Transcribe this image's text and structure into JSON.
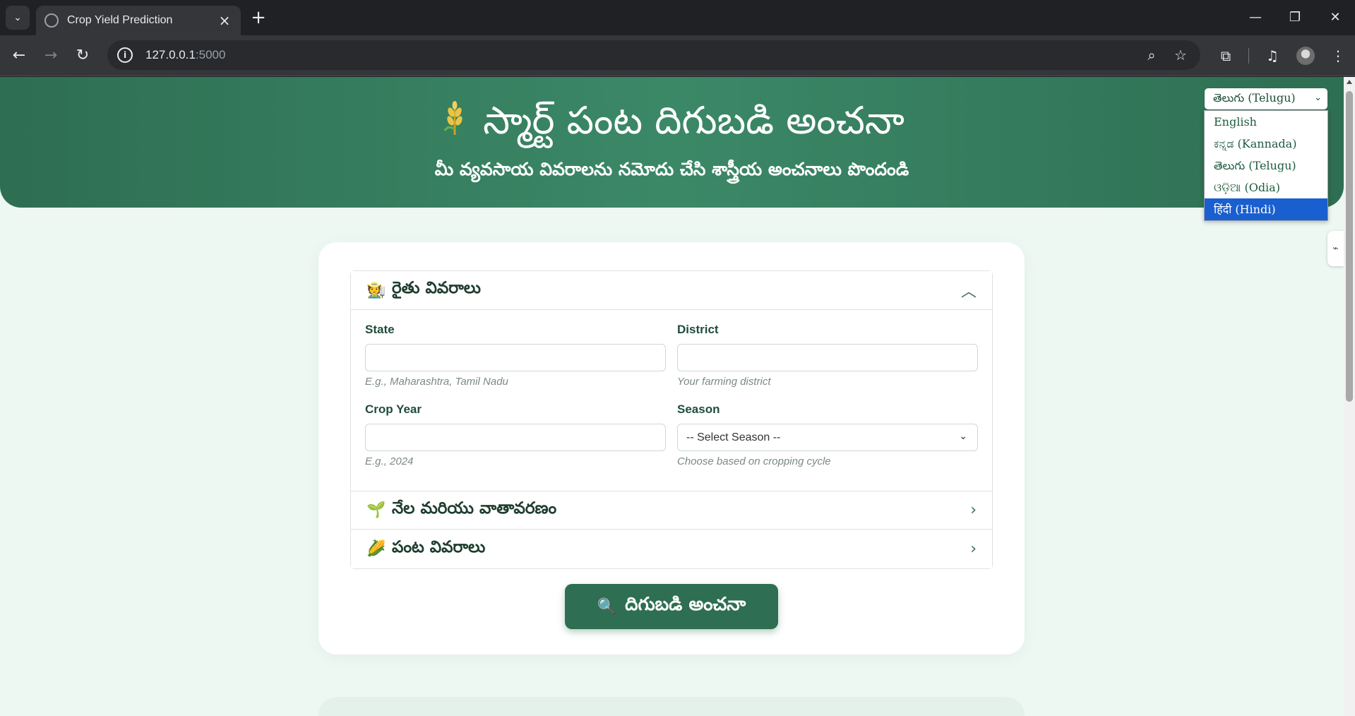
{
  "browser": {
    "tab_title": "Crop Yield Prediction",
    "url_host": "127.0.0.1",
    "url_port": ":5000"
  },
  "header": {
    "title": "స్మార్ట్ పంట దిగుబడి అంచనా",
    "subtitle": "మీ వ్యవసాయ వివరాలను నమోదు చేసి శాస్త్రీయ అంచనాలు పొందండి"
  },
  "language": {
    "selected": "తెలుగు (Telugu)",
    "options": [
      {
        "label": "English"
      },
      {
        "label": "ಕನ್ನಡ (Kannada)"
      },
      {
        "label": "తెలుగు (Telugu)"
      },
      {
        "label": "ଓଡ଼ିଆ (Odia)"
      },
      {
        "label": "हिंदी (Hindi)",
        "highlighted": true
      }
    ]
  },
  "form": {
    "sections": [
      {
        "emoji": "🧑‍🌾",
        "title": "రైతు వివరాలు",
        "expanded": true
      },
      {
        "emoji": "🌱",
        "title": "నేల మరియు వాతావరణం",
        "expanded": false
      },
      {
        "emoji": "🌽",
        "title": "పంట వివరాలు",
        "expanded": false
      }
    ],
    "fields": {
      "state": {
        "label": "State",
        "value": "",
        "hint": "E.g., Maharashtra, Tamil Nadu"
      },
      "district": {
        "label": "District",
        "value": "",
        "hint": "Your farming district"
      },
      "crop_year": {
        "label": "Crop Year",
        "value": "",
        "hint": "E.g., 2024"
      },
      "season": {
        "label": "Season",
        "value": "-- Select Season --",
        "hint": "Choose based on cropping cycle"
      }
    },
    "submit": {
      "emoji": "🔍",
      "label": "దిగుబడి అంచనా"
    }
  },
  "colors": {
    "primary": "#2e6e52",
    "background": "#eef8f3",
    "dropdown_highlight": "#1a5fcf"
  }
}
